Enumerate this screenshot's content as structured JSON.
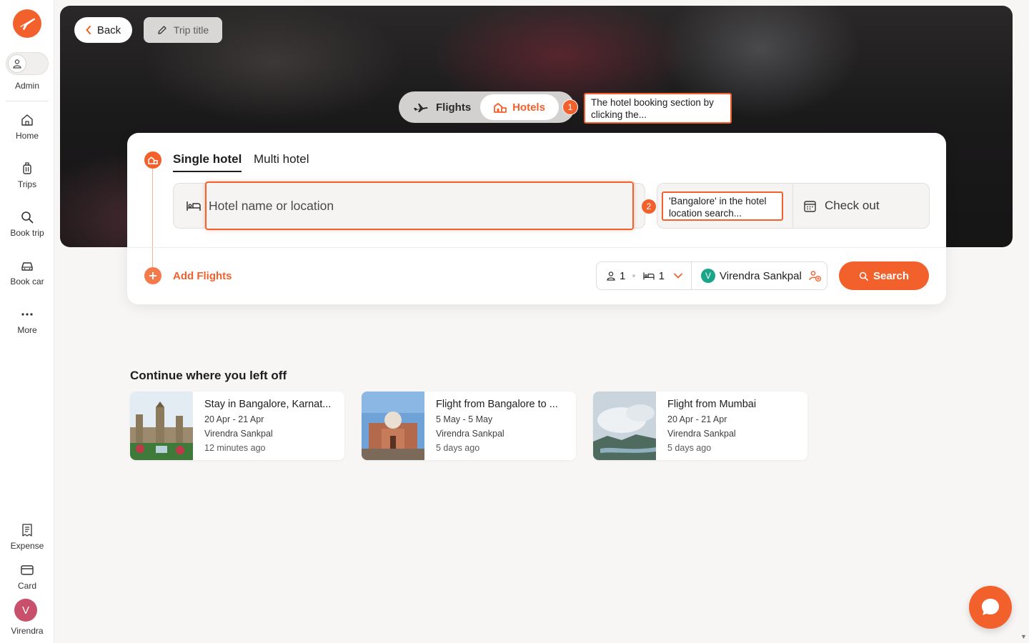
{
  "sidebar": {
    "admin_label": "Admin",
    "items": [
      {
        "label": "Home",
        "icon": "home-icon"
      },
      {
        "label": "Trips",
        "icon": "luggage-icon"
      },
      {
        "label": "Book trip",
        "icon": "search-icon"
      },
      {
        "label": "Book car",
        "icon": "car-icon"
      },
      {
        "label": "More",
        "icon": "more-icon"
      }
    ],
    "bottom_items": [
      {
        "label": "Expense",
        "icon": "receipt-icon"
      },
      {
        "label": "Card",
        "icon": "card-icon"
      }
    ],
    "user": {
      "initial": "V",
      "name": "Virendra"
    }
  },
  "header": {
    "back_label": "Back",
    "trip_title_label": "Trip title"
  },
  "mode_switch": {
    "flights_label": "Flights",
    "hotels_label": "Hotels",
    "active": "Hotels"
  },
  "annotations": [
    {
      "number": "1",
      "text": "The hotel booking section by clicking the..."
    },
    {
      "number": "2",
      "text": "'Bangalore' in the hotel location search..."
    }
  ],
  "search": {
    "tabs": [
      "Single hotel",
      "Multi hotel"
    ],
    "active_tab": "Single hotel",
    "location_placeholder": "Hotel name or location",
    "location_value": "",
    "checkout_label": "Check out",
    "add_flights_label": "Add Flights",
    "guests_count": "1",
    "rooms_count": "1",
    "traveller_initial": "V",
    "traveller_name": "Virendra Sankpal",
    "search_label": "Search"
  },
  "recent": {
    "title": "Continue where you left off",
    "items": [
      {
        "title": "Stay in Bangalore, Karnat...",
        "dates": "20 Apr - 21 Apr",
        "traveller": "Virendra Sankpal",
        "updated": "12 minutes ago"
      },
      {
        "title": "Flight from Bangalore to ...",
        "dates": "5 May - 5 May",
        "traveller": "Virendra Sankpal",
        "updated": "5 days ago"
      },
      {
        "title": "Flight from Mumbai",
        "dates": "20 Apr - 21 Apr",
        "traveller": "Virendra Sankpal",
        "updated": "5 days ago"
      }
    ]
  },
  "colors": {
    "accent": "#f2602b",
    "background": "#f7f6f4",
    "traveller_badge": "#1aa58a",
    "avatar": "#c8506a"
  }
}
